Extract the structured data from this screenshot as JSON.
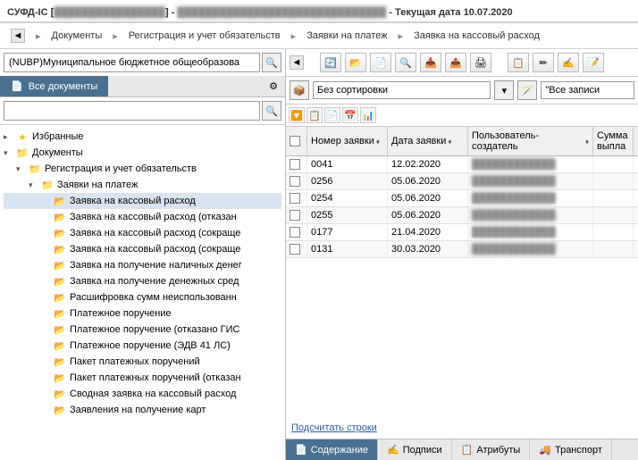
{
  "header": {
    "prefix": "СУФД-IC [",
    "redacted1": "████████████████",
    "mid": "] - ",
    "redacted2": "██████████████████████████████",
    "suffix": " - Текущая дата 10.07.2020"
  },
  "breadcrumb": {
    "items": [
      "Документы",
      "Регистрация и учет обязательств",
      "Заявки на платеж",
      "Заявка на кассовый расход"
    ]
  },
  "leftSearch": {
    "value": "(NUBP)Муниципальное бюджетное общеобразова"
  },
  "leftTab": {
    "label": "Все документы"
  },
  "tree": {
    "fav": "Избранные",
    "docs": "Документы",
    "reg": "Регистрация и учет обязательств",
    "zay": "Заявки на платеж",
    "items": [
      "Заявка на кассовый расход",
      "Заявка на кассовый расход (отказан",
      "Заявка на кассовый расход (сокраще",
      "Заявка на кассовый расход (сокраще",
      "Заявка на получение наличных денег",
      "Заявка на получение денежных сред",
      "Расшифровка сумм неиспользованн",
      "Платежное поручение",
      "Платежное поручение (отказано ГИС",
      "Платежное поручение (ЭДВ 41 ЛС)",
      "Пакет платежных поручений",
      "Пакет платежных поручений (отказан",
      "Сводная заявка на кассовый расход",
      "Заявления на получение карт"
    ]
  },
  "sort": {
    "label": "Без сортировки",
    "filter": "\"Все записи"
  },
  "table": {
    "headers": {
      "num": "Номер заявки",
      "date": "Дата заявки",
      "user": "Пользователь-создатель",
      "sum": "Сумма выпла"
    },
    "rows": [
      {
        "num": "0041",
        "date": "12.02.2020",
        "user": "████████████"
      },
      {
        "num": "0256",
        "date": "05.06.2020",
        "user": "████████████"
      },
      {
        "num": "0254",
        "date": "05.06.2020",
        "user": "████████████"
      },
      {
        "num": "0255",
        "date": "05.06.2020",
        "user": "████████████"
      },
      {
        "num": "0177",
        "date": "21.04.2020",
        "user": "████████████"
      },
      {
        "num": "0131",
        "date": "30.03.2020",
        "user": "████████████"
      }
    ]
  },
  "countLink": "Подсчитать строки",
  "bottomTabs": {
    "t1": "Содержание",
    "t2": "Подписи",
    "t3": "Атрибуты",
    "t4": "Транспорт"
  }
}
